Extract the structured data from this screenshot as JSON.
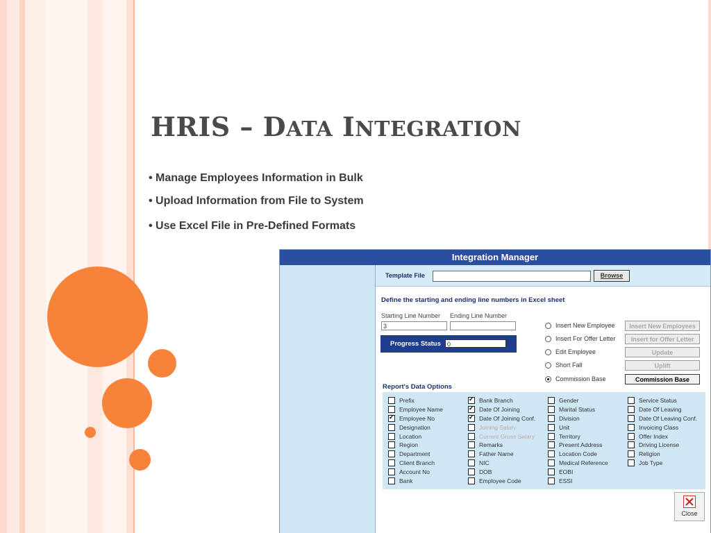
{
  "slide": {
    "title_first": "HRIS – D",
    "title_sc1": "ATA",
    "title_mid": " I",
    "title_sc2": "NTEGRATION",
    "bullets": [
      "• Manage Employees Information in Bulk",
      "• Upload Information from File to System",
      "• Use Excel File in Pre-Defined Formats"
    ]
  },
  "window": {
    "title": "Integration Manager",
    "template_label": "Template File",
    "template_value": "",
    "browse_label": "Browse",
    "define_label": "Define the starting and ending line numbers in Excel sheet",
    "starting_label": "Starting Line Number",
    "starting_value": "3",
    "ending_label": "Ending Line Number",
    "ending_value": "",
    "progress_label": "Progress Status",
    "progress_value": "0",
    "actions": [
      {
        "radio": "Insert New Employee",
        "button": "Insert New Employees",
        "selected": false,
        "enabled": false
      },
      {
        "radio": "Insert For Offer Letter",
        "button": "Insert for Offer Letter",
        "selected": false,
        "enabled": false
      },
      {
        "radio": "Edit Employee",
        "button": "Update",
        "selected": false,
        "enabled": false
      },
      {
        "radio": "Short Fall",
        "button": "Uplift",
        "selected": false,
        "enabled": false
      },
      {
        "radio": "Commission Base",
        "button": "Commission Base",
        "selected": true,
        "enabled": true
      }
    ],
    "report_title": "Report's Data Options",
    "options": {
      "col1": [
        {
          "label": "Prefix",
          "checked": false
        },
        {
          "label": "Employee Name",
          "checked": false
        },
        {
          "label": "Employee No",
          "checked": true
        },
        {
          "label": "Designation",
          "checked": false
        },
        {
          "label": "Location",
          "checked": false
        },
        {
          "label": "Region",
          "checked": false
        },
        {
          "label": "Department",
          "checked": false
        },
        {
          "label": "Client Branch",
          "checked": false
        },
        {
          "label": "Account No",
          "checked": false
        },
        {
          "label": "Bank",
          "checked": false
        }
      ],
      "col2": [
        {
          "label": "Bank Branch",
          "checked": true
        },
        {
          "label": "Date Of Joining",
          "checked": true
        },
        {
          "label": "Date Of Joining Conf.",
          "checked": true
        },
        {
          "label": "Joining Salary",
          "checked": false,
          "disabled": true
        },
        {
          "label": "Current Gross Salary",
          "checked": false,
          "disabled": true
        },
        {
          "label": "Remarks",
          "checked": false
        },
        {
          "label": "Father Name",
          "checked": false
        },
        {
          "label": "NIC",
          "checked": false
        },
        {
          "label": "DOB",
          "checked": false
        },
        {
          "label": "Employee Code",
          "checked": false
        }
      ],
      "col3": [
        {
          "label": "Gender",
          "checked": false
        },
        {
          "label": "Marital Status",
          "checked": false
        },
        {
          "label": "Division",
          "checked": false
        },
        {
          "label": "Unit",
          "checked": false
        },
        {
          "label": "Territory",
          "checked": false
        },
        {
          "label": "Present Address",
          "checked": false
        },
        {
          "label": "Location Code",
          "checked": false
        },
        {
          "label": "Medical Reference",
          "checked": false
        },
        {
          "label": "EOBI",
          "checked": false
        },
        {
          "label": "ESSI",
          "checked": false
        }
      ],
      "col4": [
        {
          "label": "Service Status",
          "checked": false
        },
        {
          "label": "Date Of Leaving",
          "checked": false
        },
        {
          "label": "Date Of Leaving Conf.",
          "checked": false
        },
        {
          "label": "Invoicing Class",
          "checked": false
        },
        {
          "label": "Offer Index",
          "checked": false
        },
        {
          "label": "Driving License",
          "checked": false
        },
        {
          "label": "Religion",
          "checked": false
        },
        {
          "label": "Job Type",
          "checked": false
        }
      ]
    },
    "close_label": "Close",
    "close_icon": "close-x-icon"
  },
  "colors": {
    "accent_orange": "#f7823a",
    "title_bar": "#2b4fa0",
    "panel": "#cfe6f5"
  }
}
